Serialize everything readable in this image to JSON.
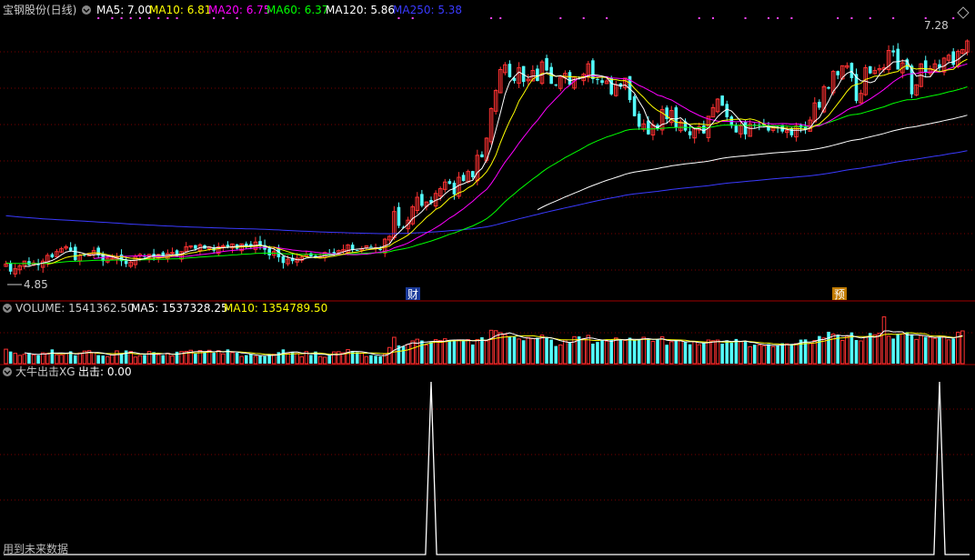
{
  "header": {
    "title": "宝钢股份(日线)",
    "ma_labels": [
      {
        "text": "MA5: 7.00",
        "color": "#ffffff"
      },
      {
        "text": "MA10: 6.81",
        "color": "#ffff00"
      },
      {
        "text": "MA20: 6.75",
        "color": "#ff00ff"
      },
      {
        "text": "MA60: 6.37",
        "color": "#00ff00"
      },
      {
        "text": "MA120: 5.86",
        "color": "#ffffff"
      },
      {
        "text": "MA250: 5.38",
        "color": "#3a3aff"
      }
    ]
  },
  "volume_header": {
    "prefix": "VOLUME: 1541362.50",
    "ma5": "MA5: 1537328.25",
    "ma10": "MA10: 1354789.50"
  },
  "indicator_header": {
    "name": "大牛出击XG",
    "value": "出击: 0.00"
  },
  "annotations": {
    "price_high": "7.28",
    "price_low": "4.85",
    "marker_cai": "财",
    "marker_yu": "预",
    "footer_note": "用到未来数据"
  },
  "colors": {
    "up": "#ff3232",
    "down": "#54ffff",
    "grid": "#7a0000",
    "ma5": "#ffffff",
    "ma10": "#ffff00",
    "ma20": "#ff00ff",
    "ma60": "#00ff00",
    "ma120": "#ffffff",
    "ma250": "#3a3aff"
  },
  "chart_data": [
    {
      "type": "candlestick",
      "title": "宝钢股份(日线)",
      "ylim": [
        4.6,
        7.5
      ],
      "close": [
        4.94,
        4.86,
        4.89,
        4.92,
        4.97,
        4.93,
        4.95,
        4.93,
        4.97,
        5.03,
        5.01,
        5.07,
        5.1,
        5.12,
        5.08,
        4.98,
        5.03,
        5.03,
        5.05,
        5.08,
        5.03,
        4.97,
        5.0,
        5.0,
        5.01,
        4.97,
        4.94,
        4.96,
        5.02,
        5.04,
        5.02,
        5.04,
        5.01,
        5.04,
        5.02,
        5.05,
        5.06,
        5.02,
        5.07,
        5.12,
        5.13,
        5.1,
        5.14,
        5.1,
        5.12,
        5.08,
        5.12,
        5.13,
        5.12,
        5.15,
        5.1,
        5.15,
        5.13,
        5.12,
        5.17,
        5.13,
        5.09,
        5.03,
        5.07,
        5.01,
        4.95,
        4.99,
        4.97,
        5.0,
        5.01,
        5.04,
        5.02,
        5.0,
        5.02,
        5.06,
        5.05,
        5.05,
        5.08,
        5.09,
        5.14,
        5.09,
        5.08,
        5.1,
        5.13,
        5.12,
        5.11,
        5.09,
        5.2,
        5.23,
        5.49,
        5.34,
        5.32,
        5.4,
        5.54,
        5.64,
        5.55,
        5.59,
        5.58,
        5.68,
        5.73,
        5.8,
        5.78,
        5.67,
        5.85,
        5.81,
        5.91,
        5.85,
        6.08,
        6.06,
        6.26,
        6.57,
        6.76,
        6.98,
        7.03,
        6.9,
        6.86,
        7.0,
        6.85,
        6.88,
        6.97,
        6.86,
        7.06,
        6.97,
        6.83,
        6.82,
        6.9,
        6.94,
        6.82,
        6.9,
        6.88,
        6.93,
        7.04,
        6.88,
        6.87,
        6.84,
        6.86,
        6.72,
        6.82,
        6.8,
        6.89,
        6.66,
        6.49,
        6.38,
        6.41,
        6.3,
        6.4,
        6.36,
        6.56,
        6.46,
        6.55,
        6.37,
        6.43,
        6.34,
        6.29,
        6.36,
        6.38,
        6.31,
        6.49,
        6.58,
        6.67,
        6.6,
        6.48,
        6.39,
        6.32,
        6.39,
        6.3,
        6.41,
        6.39,
        6.39,
        6.39,
        6.34,
        6.38,
        6.37,
        6.33,
        6.34,
        6.29,
        6.39,
        6.37,
        6.35,
        6.45,
        6.63,
        6.58,
        6.8,
        6.78,
        6.96,
        6.92,
        7.02,
        7.02,
        6.89,
        6.65,
        6.73,
        7.0,
        6.94,
        6.97,
        6.99,
        7.0,
        7.18,
        7.16,
        6.98,
        7.05,
        6.98,
        6.72,
        6.82,
        7.04,
        6.95,
        6.99,
        7.04,
        7.0,
        7.1,
        7.13,
        7.03,
        7.17,
        7.19,
        7.28
      ]
    },
    {
      "type": "bar",
      "title": "VOLUME",
      "values": [
        0.68,
        0.57,
        0.49,
        0.39,
        0.44,
        0.51,
        0.41,
        0.4,
        0.51,
        0.49,
        0.67,
        0.42,
        0.41,
        0.47,
        0.58,
        0.39,
        0.5,
        0.59,
        0.61,
        0.51,
        0.4,
        0.38,
        0.33,
        0.41,
        0.6,
        0.48,
        0.62,
        0.57,
        0.31,
        0.38,
        0.41,
        0.57,
        0.54,
        0.42,
        0.4,
        0.49,
        0.36,
        0.56,
        0.57,
        0.58,
        0.63,
        0.47,
        0.62,
        0.55,
        0.63,
        0.51,
        0.61,
        0.46,
        0.67,
        0.52,
        0.52,
        0.34,
        0.4,
        0.46,
        0.34,
        0.37,
        0.35,
        0.44,
        0.44,
        0.54,
        0.67,
        0.5,
        0.56,
        0.48,
        0.32,
        0.57,
        0.41,
        0.57,
        0.33,
        0.3,
        0.38,
        0.55,
        0.56,
        0.51,
        0.66,
        0.6,
        0.54,
        0.5,
        0.33,
        0.4,
        0.37,
        0.34,
        0.45,
        0.76,
        1.24,
        0.86,
        0.81,
        0.91,
        1.07,
        1.15,
        1.09,
        0.88,
        1.02,
        1.13,
        1.09,
        1.17,
        1.08,
        1.1,
        1.12,
        1.11,
        1.13,
        0.9,
        1.13,
        1.24,
        1.07,
        1.57,
        1.55,
        1.46,
        1.37,
        1.27,
        1.26,
        1.16,
        1.1,
        1.23,
        1.18,
        1.22,
        1.34,
        1.21,
        1.13,
        0.83,
        0.88,
        1.11,
        1.02,
        1.27,
        1.28,
        1.17,
        1.33,
        0.94,
        1.02,
        1.11,
        1.06,
        1.12,
        1.21,
        1.12,
        1.09,
        1.22,
        1.1,
        1.16,
        1.24,
        1.16,
        1.05,
        1.15,
        1.26,
        0.89,
        1.03,
        1.11,
        1.08,
        1.03,
        0.91,
        1.03,
        0.89,
        0.99,
        1.11,
        1.08,
        1.11,
        0.94,
        1.1,
        0.99,
        1.16,
        1.04,
        1.06,
        0.8,
        0.89,
        0.87,
        0.84,
        0.92,
        0.8,
        0.87,
        0.96,
        0.93,
        0.93,
        0.94,
        1.13,
        1.14,
        0.95,
        1.09,
        1.3,
        1.21,
        1.5,
        1.39,
        1.33,
        1.09,
        1.29,
        1.47,
        1.11,
        1.07,
        1.25,
        1.44,
        1.36,
        1.43,
        2.2,
        1.29,
        1.18,
        1.41,
        1.4,
        1.48,
        1.35,
        1.14,
        1.32,
        1.26,
        1.24,
        1.19,
        1.26,
        1.28,
        1.12,
        1.18,
        1.48,
        1.54
      ]
    },
    {
      "type": "line",
      "title": "大牛出击XG",
      "ylim": [
        0,
        1
      ],
      "signals": [
        {
          "index": 92,
          "value": 1
        },
        {
          "index": 202,
          "value": 1
        }
      ]
    }
  ]
}
